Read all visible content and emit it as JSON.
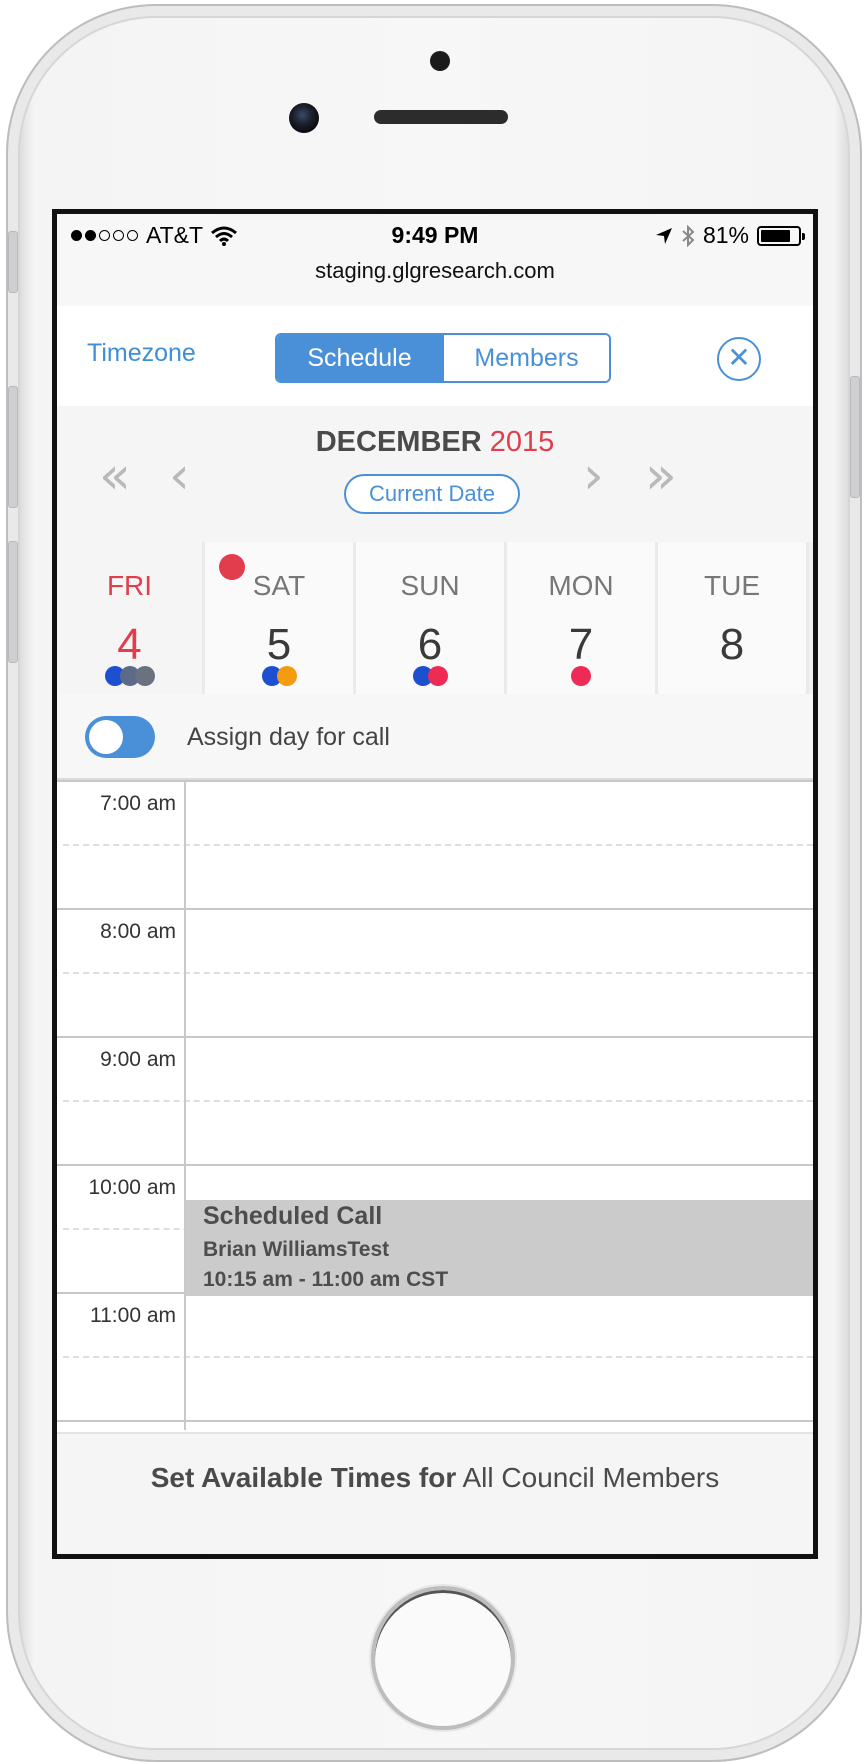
{
  "status": {
    "carrier": "AT&T",
    "signal_filled": 2,
    "signal_total": 5,
    "time": "9:49 PM",
    "battery": "81%",
    "battery_level": 0.81,
    "icons": [
      "wifi-icon",
      "location-arrow-icon",
      "bluetooth-icon",
      "battery-icon"
    ]
  },
  "url": "staging.glgresearch.com",
  "nav": {
    "timezone": "Timezone",
    "tabs": [
      {
        "label": "Schedule",
        "active": true
      },
      {
        "label": "Members",
        "active": false
      }
    ],
    "close_icon": "✕"
  },
  "month": {
    "name": "DECEMBER",
    "year": "2015",
    "prev_week_icon": "«",
    "prev_icon": "‹",
    "next_icon": "›",
    "next_week_icon": "»",
    "current_date": "Current Date"
  },
  "days": [
    {
      "name": "FRI",
      "date": "4",
      "today": true,
      "notif": false,
      "dots": [
        "#1d4fd1",
        "#5b6a86",
        "#6a7280"
      ]
    },
    {
      "name": "SAT",
      "date": "5",
      "today": false,
      "notif": true,
      "dots": [
        "#1d4fd1",
        "#f39c12"
      ]
    },
    {
      "name": "SUN",
      "date": "6",
      "today": false,
      "notif": false,
      "dots": [
        "#1d4fd1",
        "#ee2b55"
      ]
    },
    {
      "name": "MON",
      "date": "7",
      "today": false,
      "notif": false,
      "dots": [
        "#ee2b55"
      ]
    },
    {
      "name": "TUE",
      "date": "8",
      "today": false,
      "notif": false,
      "dots": []
    }
  ],
  "assign": {
    "label": "Assign day for call",
    "enabled": true
  },
  "hours": [
    "7:00 am",
    "8:00 am",
    "9:00 am",
    "10:00 am",
    "11:00 am"
  ],
  "event": {
    "title": "Scheduled Call",
    "name": "Brian WilliamsTest",
    "time": "10:15 am - 11:00 am CST"
  },
  "footer": {
    "bold": "Set Available Times for",
    "rest": "All Council Members"
  },
  "colors": {
    "accent": "#4a90d9",
    "today": "#e13d4d"
  }
}
